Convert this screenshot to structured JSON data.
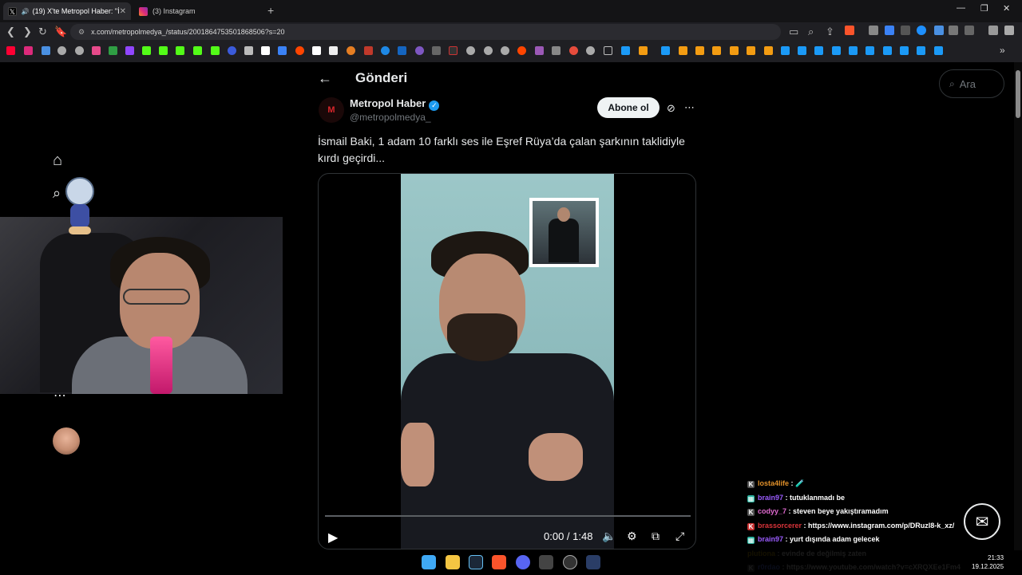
{
  "browser": {
    "tabs": [
      {
        "label": "(19) X'te Metropol Haber: \"İs",
        "active": true
      },
      {
        "label": "(3) Instagram",
        "active": false
      }
    ],
    "url": "x.com/metropolmedya_/status/2001864753501868506?s=20",
    "window_controls": [
      "—",
      "❐",
      "✕"
    ]
  },
  "post": {
    "page_title": "Gönderi",
    "author_name": "Metropol Haber",
    "author_handle": "@metropolmedya_",
    "author_avatar_letter": "M",
    "subscribe_label": "Abone ol",
    "text": "İsmail Baki, 1 adam 10 farklı ses ile Eşref Rüya’da çalan şarkının taklidiyle kırdı geçirdi...",
    "video_time": "0:00 / 1:48",
    "video_progress": 0
  },
  "search": {
    "placeholder": "Ara"
  },
  "chat": [
    {
      "user": "losta4life",
      "message": "🧪",
      "color": "#e0902a",
      "badge": "K",
      "badge_color": "#555"
    },
    {
      "user": "brain97",
      "message": "tutuklanmadı be",
      "color": "#9b5cff",
      "badge": "▦",
      "badge_color": "#2bb3a0"
    },
    {
      "user": "codyy_7",
      "message": "steven beye yakıştıramadım",
      "color": "#e06ad0",
      "badge": "K",
      "badge_color": "#555"
    },
    {
      "user": "brassorcerer",
      "message": "https://www.instagram.com/p/DRuzl8-k_xz/",
      "color": "#d9343a",
      "badge": "K",
      "badge_color": "#c33"
    },
    {
      "user": "brain97",
      "message": "yurt dışında adam gelecek",
      "color": "#9b5cff",
      "badge": "▦",
      "badge_color": "#2bb3a0"
    },
    {
      "user": "plutiona",
      "message": "evinde de değilmiş zaten",
      "color": "#d4a800",
      "badge": "",
      "badge_color": ""
    },
    {
      "user": "r0rdao",
      "message": "https://www.youtube.com/watch?v=cXRQXEe1Fm4",
      "color": "#5a7dff",
      "badge": "K",
      "badge_color": "#555"
    }
  ],
  "clock": {
    "time": "21:33",
    "date": "19.12.2025"
  },
  "colors": {
    "accent": "#1d9bf0",
    "background": "#000000",
    "text": "#e7e9ea",
    "muted": "#71767b"
  }
}
